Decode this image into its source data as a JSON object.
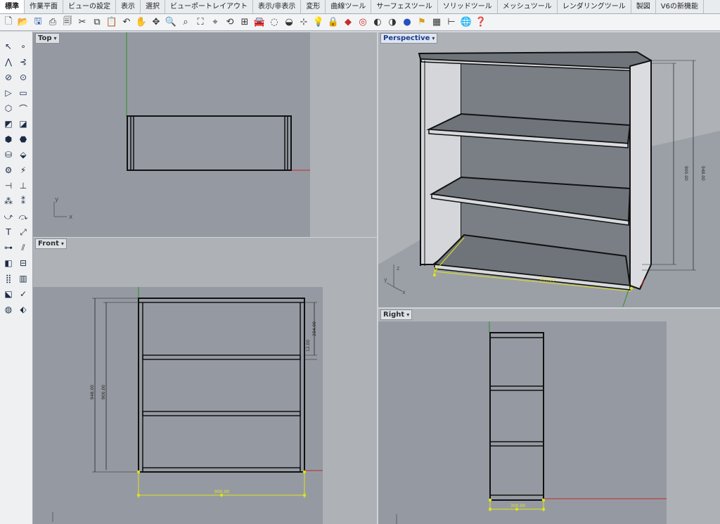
{
  "menu_tabs": [
    "標準",
    "作業平面",
    "ビューの設定",
    "表示",
    "選択",
    "ビューポートレイアウト",
    "表示/非表示",
    "変形",
    "曲線ツール",
    "サーフェスツール",
    "ソリッドツール",
    "メッシュツール",
    "レンダリングツール",
    "製図",
    "V6の新機能"
  ],
  "active_tab": "標準",
  "toolbar_icons": [
    "new-file-icon",
    "open-folder-icon",
    "save-icon",
    "print-icon",
    "import-icon",
    "cut-icon",
    "copy-icon",
    "paste-icon",
    "undo-icon",
    "pan-hand-icon",
    "rotate-view-icon",
    "zoom-icon",
    "zoom-window-icon",
    "zoom-extents-icon",
    "zoom-selected-icon",
    "rotate-camera-icon",
    "four-viewports-icon",
    "car-icon",
    "point-icon",
    "curve-icon",
    "object-snap-icon",
    "bulb-icon",
    "lock-icon",
    "layer-icon",
    "color-wheel-icon",
    "shade-icon",
    "render-icon",
    "material-sphere-icon",
    "flag-icon",
    "grid-icon",
    "gumball-icon",
    "globe-icon",
    "help-icon"
  ],
  "viewports": {
    "top": {
      "label": "Top",
      "axis_y": "y",
      "axis_x": "x"
    },
    "perspective": {
      "label": "Perspective",
      "dim_vertical_1": "900.00",
      "dim_vertical_2": "948.00",
      "dim_horizontal": "900.00",
      "axis_z": "z",
      "axis_y": "y",
      "axis_x": "x"
    },
    "front": {
      "label": "Front",
      "dim_left_outer": "948.00",
      "dim_left_inner": "900.00",
      "dim_right_top": "284.00",
      "dim_right_small": "12.00",
      "dim_bottom": "900.00"
    },
    "right": {
      "label": "Right",
      "dim_bottom": "300.00"
    }
  },
  "colors": {
    "viewport_bg": "#aeb2b7",
    "model_bg": "#959aa2",
    "dimension": "#dde21a",
    "axis_x": "#c22a25",
    "axis_y": "#2e8f2c"
  }
}
